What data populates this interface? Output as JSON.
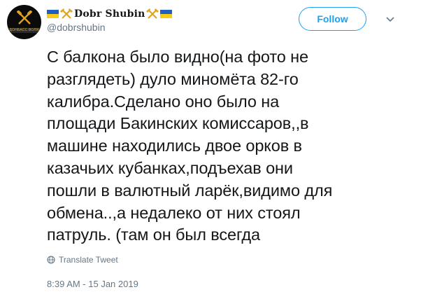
{
  "author": {
    "display_name": "Dobr Shubin",
    "handle": "@dobrshubin",
    "avatar_caption": "ДОНБАСС ВОЛЯ"
  },
  "follow_button": {
    "label": "Follow"
  },
  "tweet": {
    "text": "С балкона было видно(на фото не\nразглядеть) дуло миномёта 82-го\nкалибра.Сделано оно было на\nплощади Бакинских комиссаров,,в\nмашине находились двое орков в\nказачьих кубанках,подъехав они\nпошли в валютный ларёк,видимо для\nобмена..,а недалеко от них стоял\nпатруль. (там он был всегда"
  },
  "translate": {
    "label": "Translate Tweet"
  },
  "timestamp": "8:39 AM - 15 Jan 2019",
  "colors": {
    "accent": "#1da1f2",
    "secondary_text": "#657786",
    "flag_blue": "#1f5fc4",
    "flag_yellow": "#f7cc16",
    "tool_gold": "#e0a31f"
  },
  "icons": [
    "ukraine-flag-icon",
    "hammer-pick-icon",
    "chevron-down-icon",
    "globe-icon"
  ]
}
